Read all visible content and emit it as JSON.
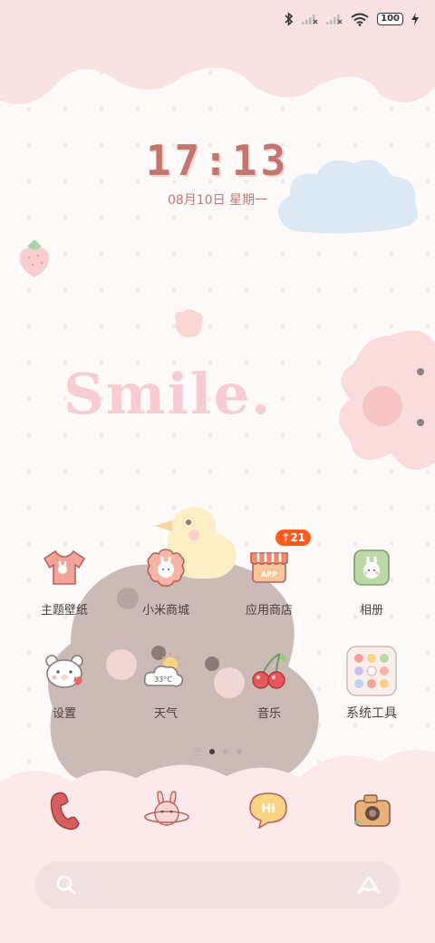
{
  "status_bar": {
    "icons": [
      "bluetooth-icon",
      "signal-no-service-icon",
      "signal-no-service-icon",
      "wifi-icon",
      "battery-icon",
      "charging-icon"
    ],
    "battery_level": "100"
  },
  "lockscreen": {
    "time": "17:13",
    "date": "08月10日 星期一"
  },
  "wallpaper": {
    "decor_text": "Smile."
  },
  "home_apps": [
    {
      "label": "主题壁纸",
      "icon": "tshirt-theme-icon"
    },
    {
      "label": "小米商城",
      "icon": "flower-bunny-store-icon"
    },
    {
      "label": "应用商店",
      "icon": "app-store-awning-icon",
      "badge": "↑21"
    },
    {
      "label": "相册",
      "icon": "gallery-bunny-icon"
    },
    {
      "label": "设置",
      "icon": "bear-settings-icon"
    },
    {
      "label": "天气",
      "icon": "weather-sun-cloud-icon",
      "temp": "33°C"
    },
    {
      "label": "音乐",
      "icon": "cherry-music-icon"
    },
    {
      "label": "系统工具",
      "icon": "system-tools-folder-icon"
    }
  ],
  "pager": {
    "pages": 3,
    "active": 1
  },
  "dock": [
    {
      "name": "phone",
      "icon": "phone-icon"
    },
    {
      "name": "messages",
      "icon": "bunny-planet-icon"
    },
    {
      "name": "browser",
      "icon": "hi-bubble-icon"
    },
    {
      "name": "camera",
      "icon": "camera-icon"
    }
  ],
  "search_bar": {
    "left_icon": "search-icon",
    "right_icon": "assistant-icon"
  },
  "colors": {
    "accent": "#c3766e",
    "cloud_pink": "#fbe2e2",
    "badge": "#ff5a1f",
    "label_text": "#4a4040"
  }
}
